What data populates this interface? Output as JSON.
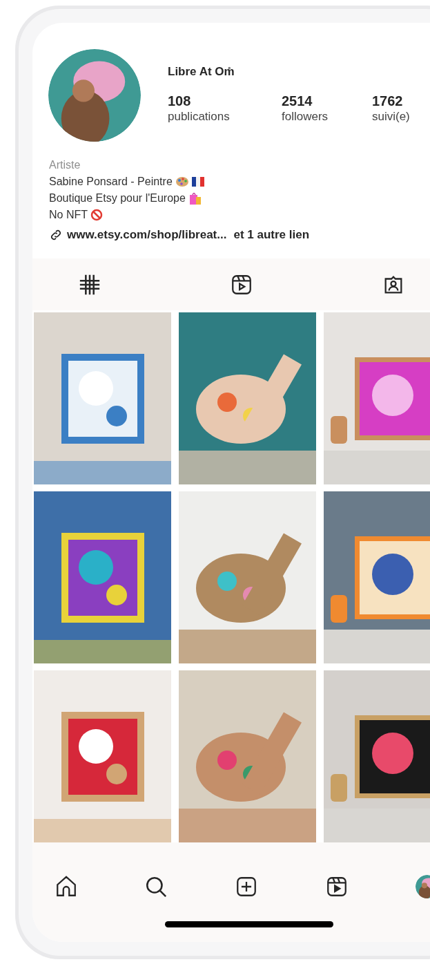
{
  "profile": {
    "name": "Libre At Om̊",
    "stats": [
      {
        "value": "108",
        "label": "publications"
      },
      {
        "value": "2514",
        "label": "followers"
      },
      {
        "value": "1762",
        "label": "suivi(e)"
      }
    ],
    "category": "Artiste",
    "bio": [
      {
        "text": "Sabine Ponsard - Peintre",
        "kind": "palette"
      },
      {
        "text": "Boutique Etsy pour l'Europe",
        "kind": "bags"
      },
      {
        "text": "No NFT",
        "kind": "prohibited"
      }
    ],
    "link": {
      "url": "www.etsy.com/shop/libreat...",
      "extra": "et 1 autre lien"
    }
  }
}
